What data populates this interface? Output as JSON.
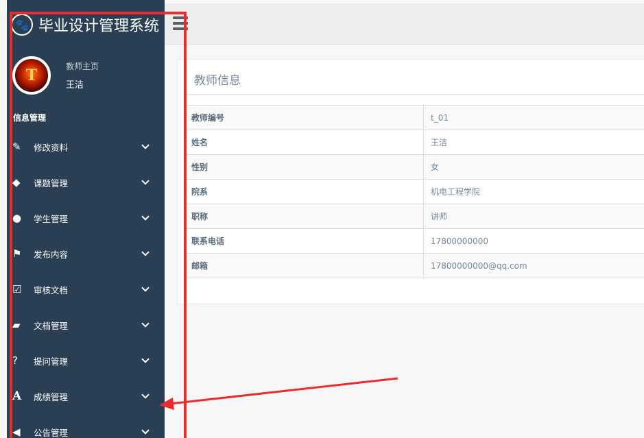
{
  "app": {
    "title": "毕业设计管理系统",
    "brand_icon": "paw-icon"
  },
  "profile": {
    "role": "教师主页",
    "name": "王洁",
    "avatar_letter": "T"
  },
  "sidebar": {
    "section_title": "信息管理",
    "items": [
      {
        "label": "修改资料",
        "icon": "edit-icon",
        "glyph": "✎"
      },
      {
        "label": "课题管理",
        "icon": "tags-icon",
        "glyph": "◆"
      },
      {
        "label": "学生管理",
        "icon": "user-icon",
        "glyph": "●"
      },
      {
        "label": "发布内容",
        "icon": "flag-icon",
        "glyph": "⚑"
      },
      {
        "label": "审核文档",
        "icon": "check-square-icon",
        "glyph": "☑"
      },
      {
        "label": "文档管理",
        "icon": "folder-open-icon",
        "glyph": "▰"
      },
      {
        "label": "提问管理",
        "icon": "question-circle-icon",
        "glyph": "?"
      },
      {
        "label": "成绩管理",
        "icon": "font-icon",
        "glyph": "A"
      },
      {
        "label": "公告管理",
        "icon": "bullhorn-icon",
        "glyph": "◀"
      }
    ]
  },
  "panel": {
    "title": "教师信息"
  },
  "teacher_info": {
    "rows": [
      {
        "key": "教师编号",
        "value": "t_01"
      },
      {
        "key": "姓名",
        "value": "王洁"
      },
      {
        "key": "性别",
        "value": "女"
      },
      {
        "key": "院系",
        "value": "机电工程学院"
      },
      {
        "key": "职称",
        "value": "讲师"
      },
      {
        "key": "联系电话",
        "value": "17800000000"
      },
      {
        "key": "邮箱",
        "value": "17800000000@qq.com"
      }
    ]
  },
  "colors": {
    "sidebar_bg": "#2a3f54",
    "annotation_red": "#ee2b2b",
    "muted_text": "#73879c"
  }
}
